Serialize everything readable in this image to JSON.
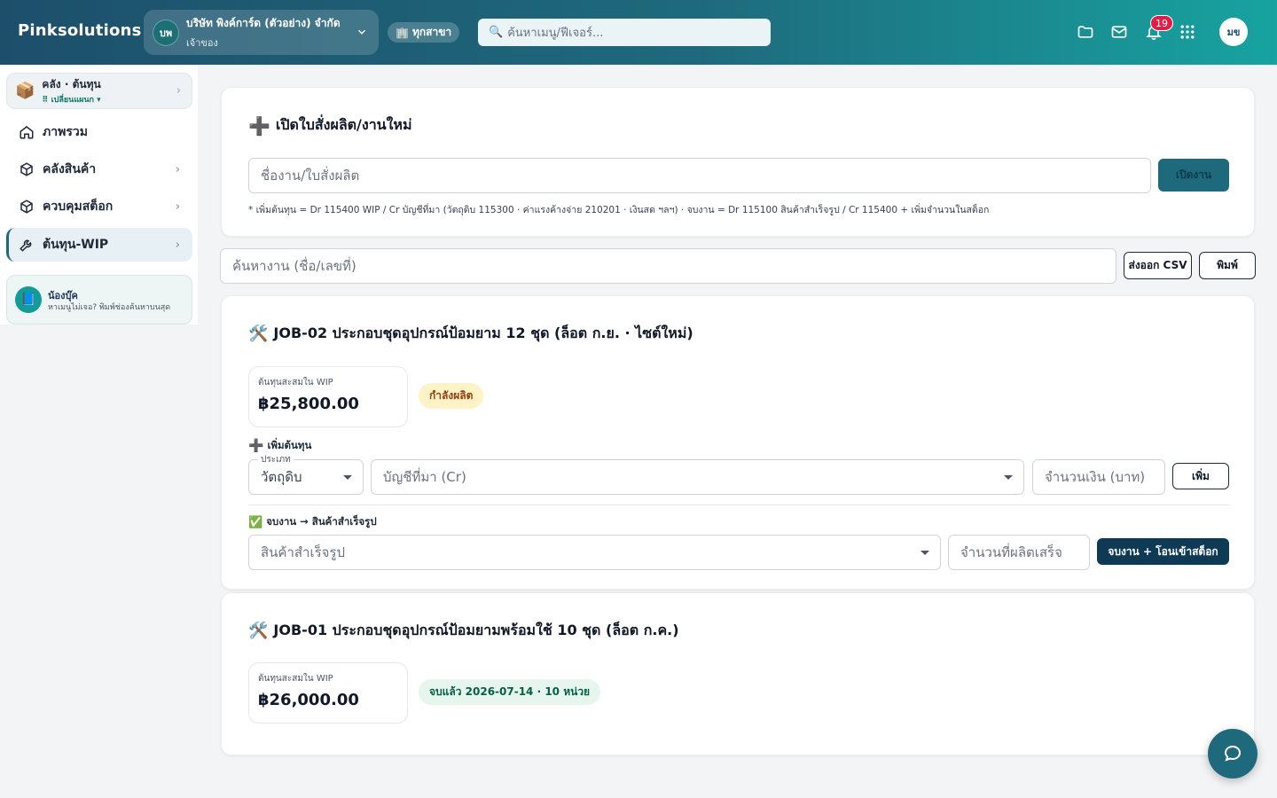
{
  "header": {
    "brand": "Pinksolutions",
    "company": {
      "initials": "บพ",
      "name": "บริษัท พิงค์การ์ด (ตัวอย่าง) จำกัด",
      "role": "เจ้าของ"
    },
    "branch_label": "ทุกสาขา",
    "search_placeholder": "ค้นหาเมนู/ฟีเจอร์...",
    "notification_count": "19",
    "user_initials": "มข"
  },
  "sidebar": {
    "warehouse": {
      "title": "คลัง · ต้นทุน",
      "subtitle": "⠿ เปลี่ยนแผนก ▾"
    },
    "items": [
      {
        "label": "ภาพรวม",
        "icon": "home-icon"
      },
      {
        "label": "คลังสินค้า",
        "icon": "box-icon"
      },
      {
        "label": "ควบคุมสต็อก",
        "icon": "box-icon"
      },
      {
        "label": "ต้นทุน-WIP",
        "icon": "wrench-icon"
      }
    ],
    "helper": {
      "title": "น้องบุ๊ค",
      "text": "หาเมนูไม่เจอ? พิมพ์ช่องค้นหาบนสุด"
    }
  },
  "new_job": {
    "title": "เปิดใบสั่งผลิต/งานใหม่",
    "input_placeholder": "ชื่องาน/ใบสั่งผลิต",
    "open_button": "เปิดงาน",
    "note": "* เพิ่มต้นทุน = Dr 115400 WIP / Cr บัญชีที่มา (วัตถุดิบ 115300 · ค่าแรงค้างจ่าย 210201 · เงินสด ฯลฯ) · จบงาน = Dr 115100 สินค้าสำเร็จรูป / Cr 115400 + เพิ่มจำนวนในสต็อก"
  },
  "toolbar": {
    "search_placeholder": "ค้นหางาน (ชื่อ/เลขที่)",
    "export_csv": "ส่งออก CSV",
    "print": "พิมพ์"
  },
  "jobs": [
    {
      "title": "JOB-02 ประกอบชุดอุปกรณ์ป้อมยาม 12 ชุด (ล็อต ก.ย. · ไซต์ใหม่)",
      "wip_label": "ต้นทุนสะสมใน WIP",
      "wip_value": "฿25,800.00",
      "status": "กำลังผลิต",
      "add_cost": {
        "heading": "เพิ่มต้นทุน",
        "type_label": "ประเภท",
        "type_value": "วัตถุดิบ",
        "account_placeholder": "บัญชีที่มา (Cr)",
        "amount_placeholder": "จำนวนเงิน (บาท)",
        "add_button": "เพิ่ม"
      },
      "finish": {
        "heading": "จบงาน → สินค้าสำเร็จรูป",
        "product_placeholder": "สินค้าสำเร็จรูป",
        "qty_placeholder": "จำนวนที่ผลิตเสร็จ",
        "button": "จบงาน + โอนเข้าสต็อก"
      }
    },
    {
      "title": "JOB-01 ประกอบชุดอุปกรณ์ป้อมยามพร้อมใช้ 10 ชุด (ล็อต ก.ค.)",
      "wip_label": "ต้นทุนสะสมใน WIP",
      "wip_value": "฿26,000.00",
      "status": "จบแล้ว 2026-07-14 · 10 หน่วย"
    }
  ],
  "colors": {
    "accent": "#1e6a7c",
    "header_start": "#1d4f6b",
    "header_end": "#17a3a0",
    "status_active": "#fef3c7",
    "status_done": "#e6f6ee"
  }
}
